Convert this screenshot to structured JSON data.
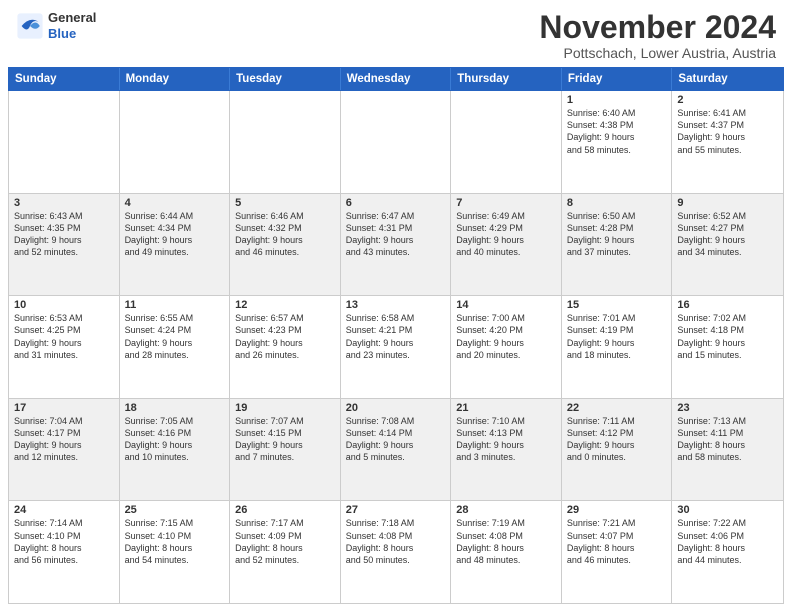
{
  "header": {
    "logo": {
      "general": "General",
      "blue": "Blue"
    },
    "month_title": "November 2024",
    "location": "Pottschach, Lower Austria, Austria"
  },
  "weekdays": [
    "Sunday",
    "Monday",
    "Tuesday",
    "Wednesday",
    "Thursday",
    "Friday",
    "Saturday"
  ],
  "weeks": [
    [
      {
        "day": "",
        "info": "",
        "bg": "odd"
      },
      {
        "day": "",
        "info": "",
        "bg": "odd"
      },
      {
        "day": "",
        "info": "",
        "bg": "odd"
      },
      {
        "day": "",
        "info": "",
        "bg": "odd"
      },
      {
        "day": "",
        "info": "",
        "bg": "odd"
      },
      {
        "day": "1",
        "info": "Sunrise: 6:40 AM\nSunset: 4:38 PM\nDaylight: 9 hours\nand 58 minutes.",
        "bg": "odd"
      },
      {
        "day": "2",
        "info": "Sunrise: 6:41 AM\nSunset: 4:37 PM\nDaylight: 9 hours\nand 55 minutes.",
        "bg": "odd"
      }
    ],
    [
      {
        "day": "3",
        "info": "Sunrise: 6:43 AM\nSunset: 4:35 PM\nDaylight: 9 hours\nand 52 minutes.",
        "bg": "even"
      },
      {
        "day": "4",
        "info": "Sunrise: 6:44 AM\nSunset: 4:34 PM\nDaylight: 9 hours\nand 49 minutes.",
        "bg": "even"
      },
      {
        "day": "5",
        "info": "Sunrise: 6:46 AM\nSunset: 4:32 PM\nDaylight: 9 hours\nand 46 minutes.",
        "bg": "even"
      },
      {
        "day": "6",
        "info": "Sunrise: 6:47 AM\nSunset: 4:31 PM\nDaylight: 9 hours\nand 43 minutes.",
        "bg": "even"
      },
      {
        "day": "7",
        "info": "Sunrise: 6:49 AM\nSunset: 4:29 PM\nDaylight: 9 hours\nand 40 minutes.",
        "bg": "even"
      },
      {
        "day": "8",
        "info": "Sunrise: 6:50 AM\nSunset: 4:28 PM\nDaylight: 9 hours\nand 37 minutes.",
        "bg": "even"
      },
      {
        "day": "9",
        "info": "Sunrise: 6:52 AM\nSunset: 4:27 PM\nDaylight: 9 hours\nand 34 minutes.",
        "bg": "even"
      }
    ],
    [
      {
        "day": "10",
        "info": "Sunrise: 6:53 AM\nSunset: 4:25 PM\nDaylight: 9 hours\nand 31 minutes.",
        "bg": "odd"
      },
      {
        "day": "11",
        "info": "Sunrise: 6:55 AM\nSunset: 4:24 PM\nDaylight: 9 hours\nand 28 minutes.",
        "bg": "odd"
      },
      {
        "day": "12",
        "info": "Sunrise: 6:57 AM\nSunset: 4:23 PM\nDaylight: 9 hours\nand 26 minutes.",
        "bg": "odd"
      },
      {
        "day": "13",
        "info": "Sunrise: 6:58 AM\nSunset: 4:21 PM\nDaylight: 9 hours\nand 23 minutes.",
        "bg": "odd"
      },
      {
        "day": "14",
        "info": "Sunrise: 7:00 AM\nSunset: 4:20 PM\nDaylight: 9 hours\nand 20 minutes.",
        "bg": "odd"
      },
      {
        "day": "15",
        "info": "Sunrise: 7:01 AM\nSunset: 4:19 PM\nDaylight: 9 hours\nand 18 minutes.",
        "bg": "odd"
      },
      {
        "day": "16",
        "info": "Sunrise: 7:02 AM\nSunset: 4:18 PM\nDaylight: 9 hours\nand 15 minutes.",
        "bg": "odd"
      }
    ],
    [
      {
        "day": "17",
        "info": "Sunrise: 7:04 AM\nSunset: 4:17 PM\nDaylight: 9 hours\nand 12 minutes.",
        "bg": "even"
      },
      {
        "day": "18",
        "info": "Sunrise: 7:05 AM\nSunset: 4:16 PM\nDaylight: 9 hours\nand 10 minutes.",
        "bg": "even"
      },
      {
        "day": "19",
        "info": "Sunrise: 7:07 AM\nSunset: 4:15 PM\nDaylight: 9 hours\nand 7 minutes.",
        "bg": "even"
      },
      {
        "day": "20",
        "info": "Sunrise: 7:08 AM\nSunset: 4:14 PM\nDaylight: 9 hours\nand 5 minutes.",
        "bg": "even"
      },
      {
        "day": "21",
        "info": "Sunrise: 7:10 AM\nSunset: 4:13 PM\nDaylight: 9 hours\nand 3 minutes.",
        "bg": "even"
      },
      {
        "day": "22",
        "info": "Sunrise: 7:11 AM\nSunset: 4:12 PM\nDaylight: 9 hours\nand 0 minutes.",
        "bg": "even"
      },
      {
        "day": "23",
        "info": "Sunrise: 7:13 AM\nSunset: 4:11 PM\nDaylight: 8 hours\nand 58 minutes.",
        "bg": "even"
      }
    ],
    [
      {
        "day": "24",
        "info": "Sunrise: 7:14 AM\nSunset: 4:10 PM\nDaylight: 8 hours\nand 56 minutes.",
        "bg": "odd"
      },
      {
        "day": "25",
        "info": "Sunrise: 7:15 AM\nSunset: 4:10 PM\nDaylight: 8 hours\nand 54 minutes.",
        "bg": "odd"
      },
      {
        "day": "26",
        "info": "Sunrise: 7:17 AM\nSunset: 4:09 PM\nDaylight: 8 hours\nand 52 minutes.",
        "bg": "odd"
      },
      {
        "day": "27",
        "info": "Sunrise: 7:18 AM\nSunset: 4:08 PM\nDaylight: 8 hours\nand 50 minutes.",
        "bg": "odd"
      },
      {
        "day": "28",
        "info": "Sunrise: 7:19 AM\nSunset: 4:08 PM\nDaylight: 8 hours\nand 48 minutes.",
        "bg": "odd"
      },
      {
        "day": "29",
        "info": "Sunrise: 7:21 AM\nSunset: 4:07 PM\nDaylight: 8 hours\nand 46 minutes.",
        "bg": "odd"
      },
      {
        "day": "30",
        "info": "Sunrise: 7:22 AM\nSunset: 4:06 PM\nDaylight: 8 hours\nand 44 minutes.",
        "bg": "odd"
      }
    ]
  ]
}
